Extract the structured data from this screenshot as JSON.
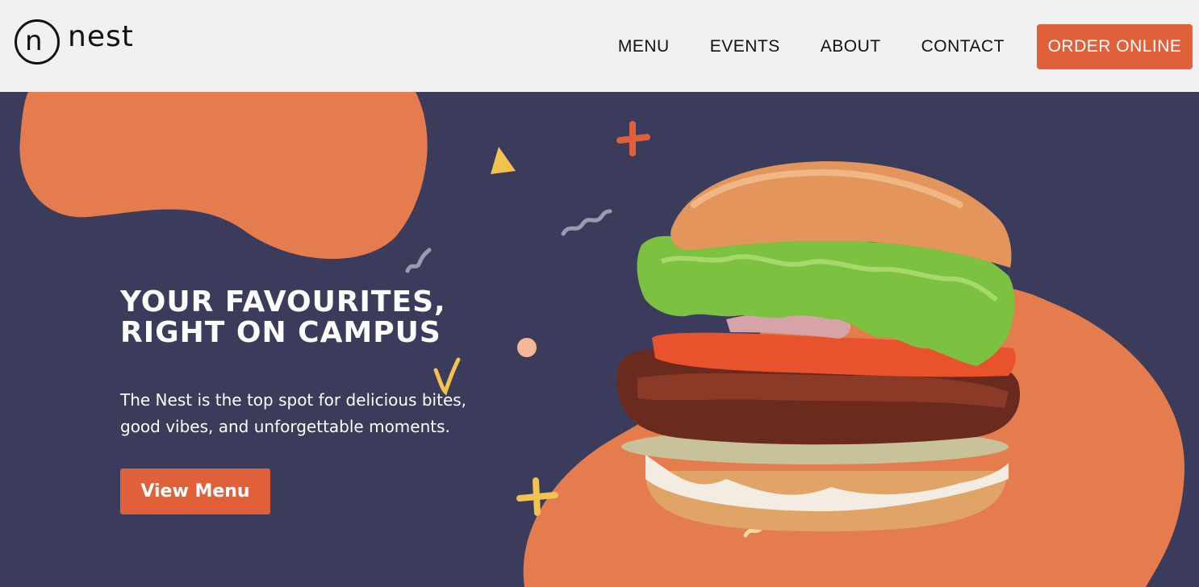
{
  "brand": {
    "logo_letter": "n",
    "name": "nest"
  },
  "nav": {
    "items": [
      {
        "label": "MENU"
      },
      {
        "label": "EVENTS"
      },
      {
        "label": "ABOUT"
      },
      {
        "label": "CONTACT"
      }
    ],
    "order_button": "ORDER ONLINE"
  },
  "hero": {
    "headline_line1": "YOUR FAVOURITES,",
    "headline_line2": "RIGHT ON CAMPUS",
    "subtext_line1": "The Nest is the top spot for delicious bites,",
    "subtext_line2": "good vibes, and unforgettable moments.",
    "cta_label": "View Menu",
    "image_subject": "burger-image"
  },
  "colors": {
    "accent": "#e0603a",
    "blob": "#e57c4e",
    "hero_bg": "#3b3c5b",
    "topbar_bg": "#f1f1f1",
    "confetti_yellow": "#f2c14e",
    "confetti_grey": "#9a9bb0",
    "confetti_peach": "#f5b795"
  }
}
